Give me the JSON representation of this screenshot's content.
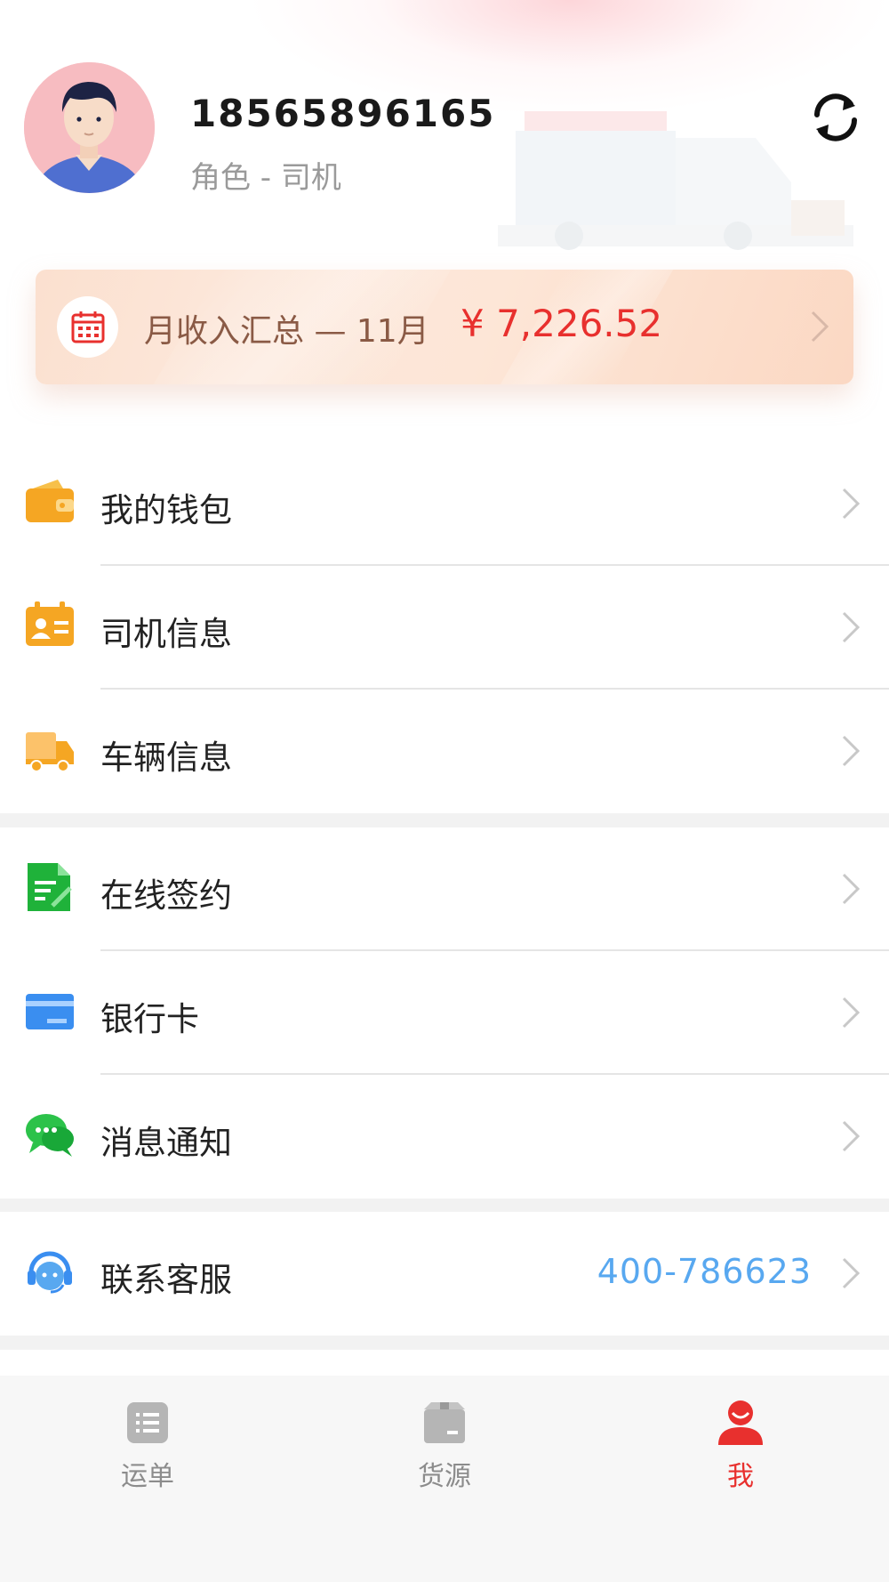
{
  "profile": {
    "phone": "18565896165",
    "role": "角色 - 司机"
  },
  "income": {
    "label": "月收入汇总 — 11月",
    "amount": "¥ 7,226.52"
  },
  "menu": {
    "group1": [
      {
        "label": "我的钱包",
        "icon": "wallet-icon"
      },
      {
        "label": "司机信息",
        "icon": "driver-card-icon"
      },
      {
        "label": "车辆信息",
        "icon": "truck-icon"
      }
    ],
    "group2": [
      {
        "label": "在线签约",
        "icon": "contract-icon"
      },
      {
        "label": "银行卡",
        "icon": "bank-card-icon"
      },
      {
        "label": "消息通知",
        "icon": "message-icon"
      }
    ],
    "service": {
      "label": "联系客服",
      "phone": "400-786623",
      "icon": "customer-service-icon"
    }
  },
  "tabbar": {
    "tabs": [
      {
        "label": "运单",
        "icon": "waybill-icon"
      },
      {
        "label": "货源",
        "icon": "cargo-box-icon"
      },
      {
        "label": "我",
        "icon": "profile-icon"
      }
    ],
    "active_index": 2
  },
  "colors": {
    "accent_red": "#e8302e",
    "link_blue": "#58a8f0",
    "icon_orange": "#f5a623",
    "icon_green": "#1fb23a",
    "icon_blue": "#3a8ef0"
  }
}
